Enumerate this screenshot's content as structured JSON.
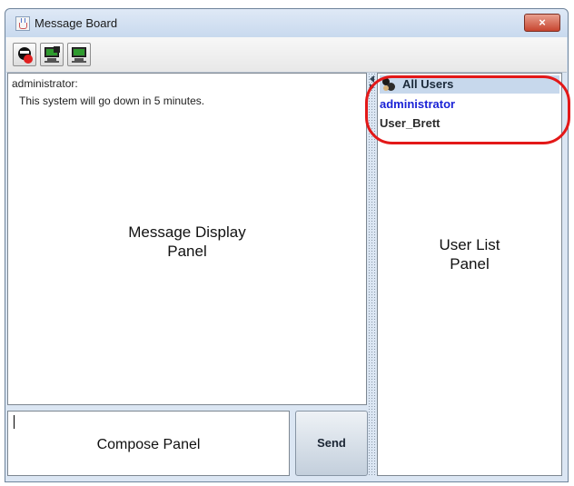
{
  "window": {
    "title": "Message Board",
    "close_glyph": "×",
    "app_icon": "java-app-icon"
  },
  "toolbar": {
    "buttons": [
      {
        "name": "do-not-disturb-button",
        "icon": "user-block-icon"
      },
      {
        "name": "monitor-tool-button",
        "icon": "monitor-tool-icon"
      },
      {
        "name": "monitor-view-button",
        "icon": "monitor-face-icon"
      }
    ]
  },
  "message_panel": {
    "sender": "administrator:",
    "message": "This system will go down in 5 minutes.",
    "label_line1": "Message Display",
    "label_line2": "Panel"
  },
  "compose": {
    "value": "",
    "label": "Compose Panel",
    "send_label": "Send"
  },
  "user_list": {
    "header": "All Users",
    "users": [
      {
        "name": "administrator",
        "active": true
      },
      {
        "name": "User_Brett",
        "active": false
      }
    ],
    "label_line1": "User List",
    "label_line2": "Panel"
  },
  "colors": {
    "window_bg": "#dbe6f3",
    "header_bg": "#c7d8ec",
    "active_user": "#1a22d6",
    "highlight": "#e31818",
    "close_button": "#c7452f"
  }
}
